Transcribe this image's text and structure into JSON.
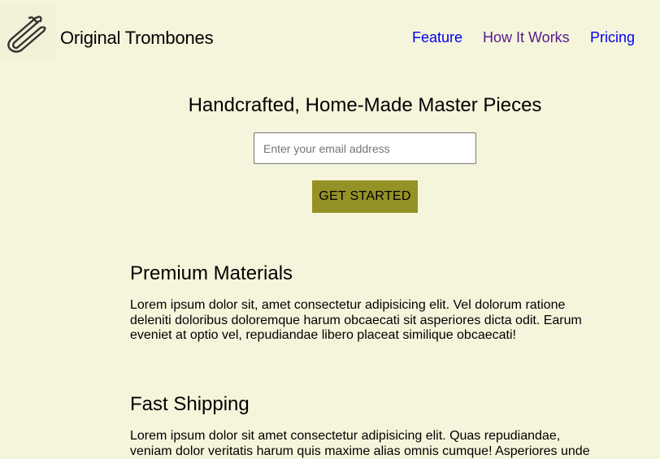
{
  "brand": {
    "name": "Original Trombones",
    "logo_icon": "trombone-icon"
  },
  "nav": {
    "items": [
      {
        "label": "Feature",
        "color": "#0000ee"
      },
      {
        "label": "How It Works",
        "color": "#551a8b"
      },
      {
        "label": "Pricing",
        "color": "#0000ee"
      }
    ]
  },
  "hero": {
    "title": "Handcrafted, Home-Made Master Pieces",
    "email_placeholder": "Enter your email address",
    "email_value": "",
    "cta_label": "GET STARTED",
    "cta_color": "#949226"
  },
  "features": [
    {
      "title": "Premium Materials",
      "body": "Lorem ipsum dolor sit, amet consectetur adipisicing elit. Vel dolorum ratione deleniti doloribus doloremque harum obcaecati sit asperiores dicta odit. Earum eveniet at optio vel, repudiandae libero placeat similique obcaecati!"
    },
    {
      "title": "Fast Shipping",
      "body": "Lorem ipsum dolor sit amet consectetur adipisicing elit. Quas repudiandae, veniam dolor veritatis harum quis maxime alias omnis cumque! Asperiores unde"
    }
  ],
  "colors": {
    "background": "#f5f5dc"
  }
}
